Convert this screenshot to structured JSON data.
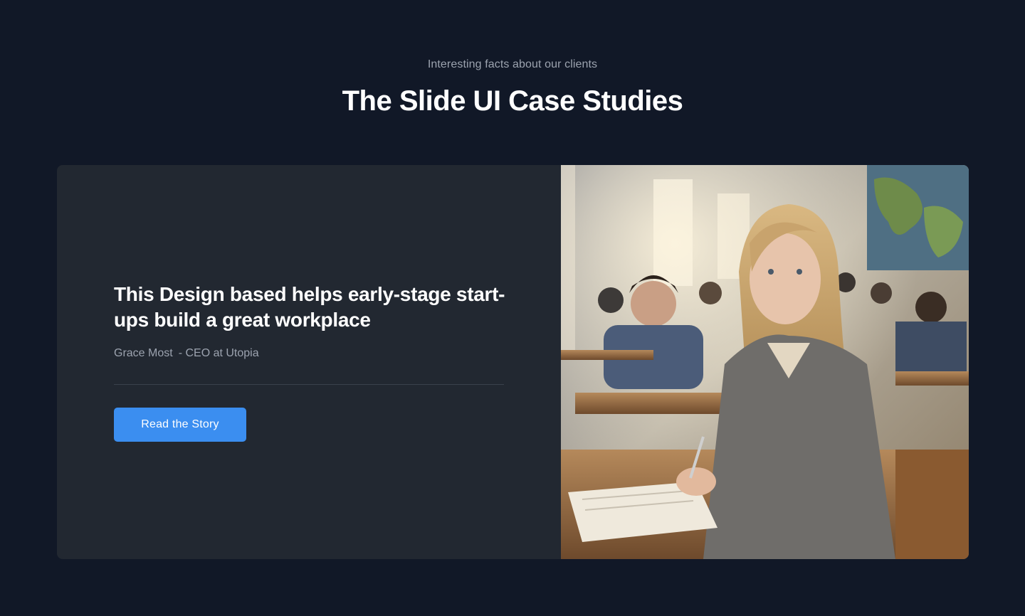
{
  "section": {
    "eyebrow": "Interesting facts about our clients",
    "title": "The Slide UI Case Studies"
  },
  "card": {
    "heading": "This Design based helps early-stage start-ups build a great workplace",
    "author_name": "Grace Most",
    "author_role": "- CEO at Utopia",
    "button_label": "Read the Story",
    "image_description_icon": "classroom-photo"
  },
  "colors": {
    "background": "#111827",
    "card": "#222831",
    "accent": "#3b8ef0",
    "muted_text": "#9ca3af"
  }
}
